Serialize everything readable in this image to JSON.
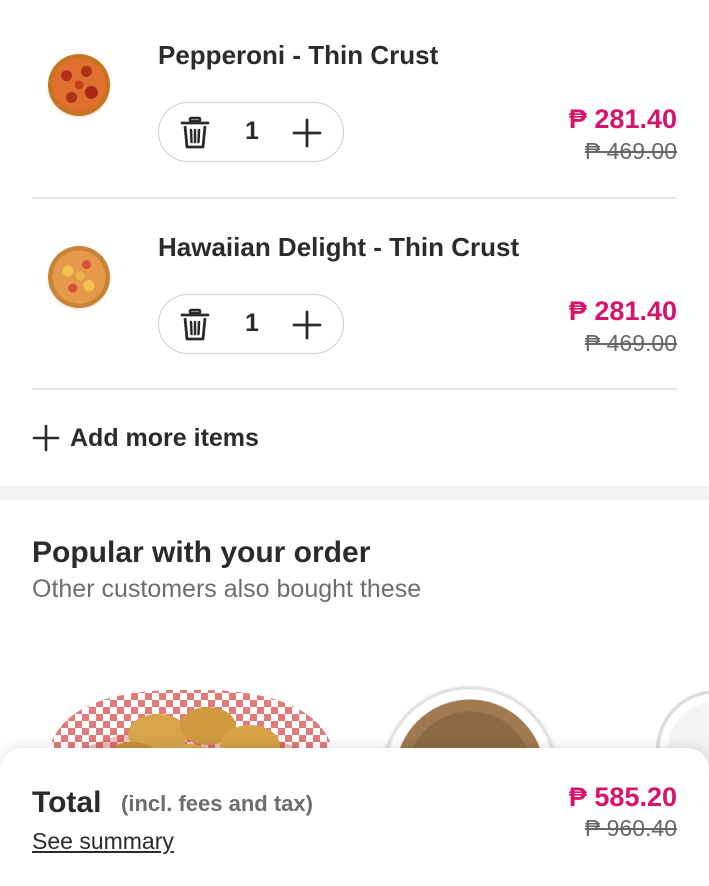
{
  "cart": {
    "items": [
      {
        "name": "Pepperoni - Thin Crust",
        "quantity": "1",
        "price": "₱ 281.40",
        "original_price": "₱ 469.00"
      },
      {
        "name": "Hawaiian Delight - Thin Crust",
        "quantity": "1",
        "price": "₱ 281.40",
        "original_price": "₱ 469.00"
      }
    ],
    "add_more_label": "Add more items"
  },
  "popular": {
    "title": "Popular with your order",
    "subtitle": "Other customers also bought these"
  },
  "footer": {
    "total_label": "Total",
    "total_note": "(incl. fees and tax)",
    "see_summary_label": "See summary",
    "total_price": "₱ 585.20",
    "total_original_price": "₱ 960.40"
  },
  "colors": {
    "accent": "#d7136a",
    "text": "#2b2b2b",
    "muted": "#6d6d6d"
  }
}
